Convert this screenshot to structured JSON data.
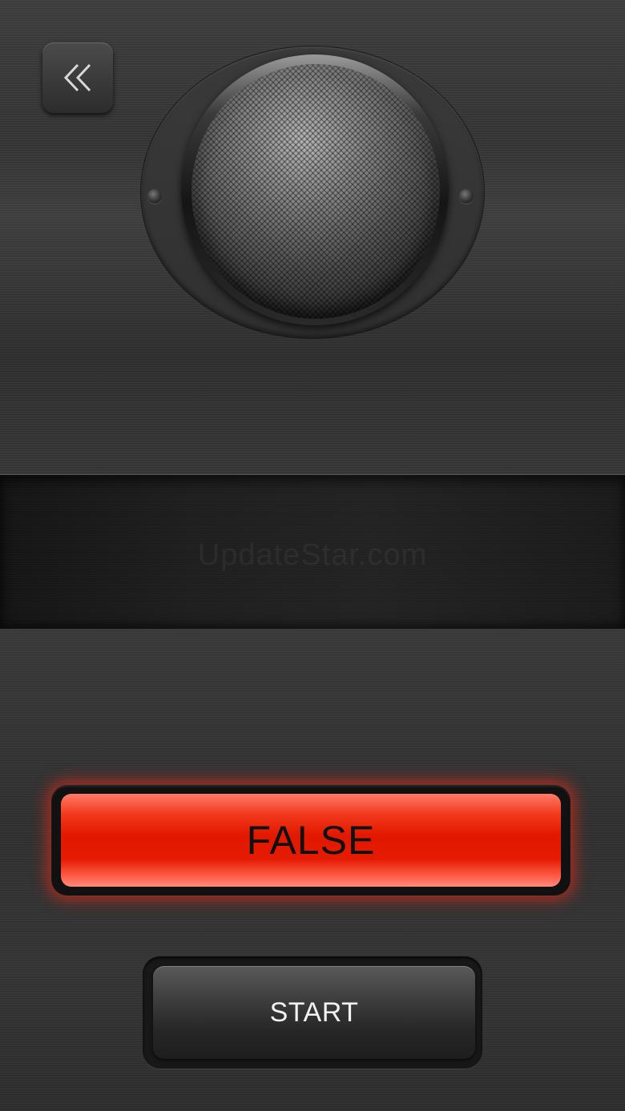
{
  "watermark": "UpdateStar.com",
  "back_button": {
    "icon": "double-chevron-left-icon"
  },
  "speaker": {
    "icon": "speaker-grill-icon"
  },
  "status": {
    "label": "FALSE",
    "color": "#e21800"
  },
  "start_button": {
    "label": "START"
  }
}
